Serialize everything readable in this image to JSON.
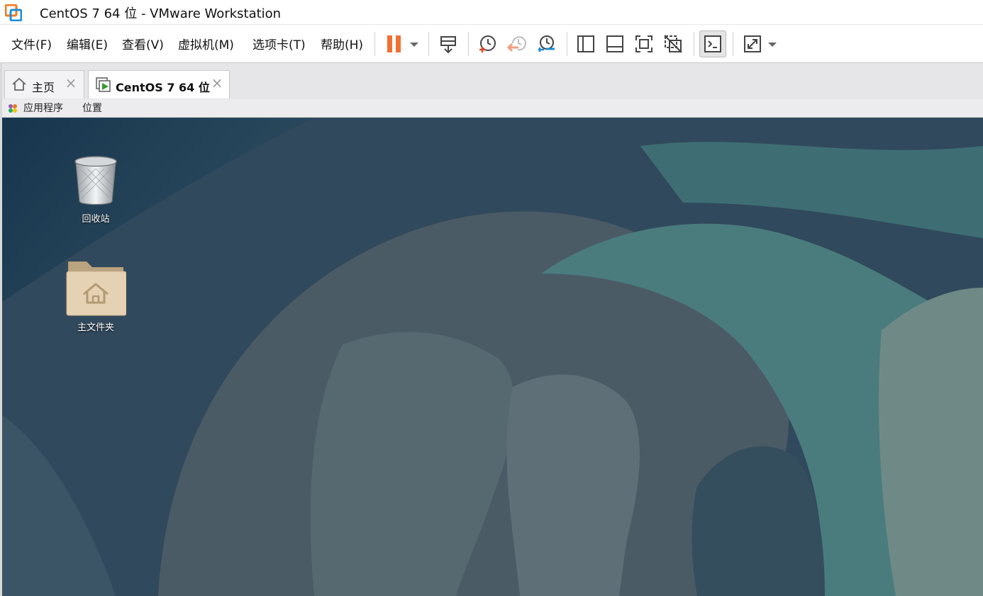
{
  "window": {
    "title": "CentOS 7 64 位 - VMware Workstation"
  },
  "menu": [
    {
      "label": "文件(F)"
    },
    {
      "label": "编辑(E)"
    },
    {
      "label": "查看(V)"
    },
    {
      "label": "虚拟机(M)"
    },
    {
      "label": "选项卡(T)"
    },
    {
      "label": "帮助(H)"
    }
  ],
  "toolbar": {
    "icons": [
      "pause-icon",
      "send-ctrl-alt-del-icon",
      "snapshot-take-icon",
      "snapshot-revert-icon",
      "snapshot-manager-icon",
      "library-view-icon",
      "thumbnail-bar-icon",
      "full-screen-icon",
      "unity-icon",
      "console-view-icon",
      "stretch-icon"
    ],
    "pause_color": "#f07032"
  },
  "tabs": [
    {
      "label": "主页",
      "icon": "home-icon",
      "active": false
    },
    {
      "label": "CentOS 7 64 位",
      "icon": "vm-running-icon",
      "active": true
    }
  ],
  "guest_bar": {
    "applications": "应用程序",
    "places": "位置"
  },
  "desktop": {
    "icons": [
      {
        "label": "回收站",
        "icon": "trash-icon"
      },
      {
        "label": "主文件夹",
        "icon": "home-folder-icon"
      }
    ]
  },
  "colors": {
    "accent": "#f07032",
    "desktop_dark": "#1f3b52",
    "desktop_teal": "#4f7d80"
  }
}
